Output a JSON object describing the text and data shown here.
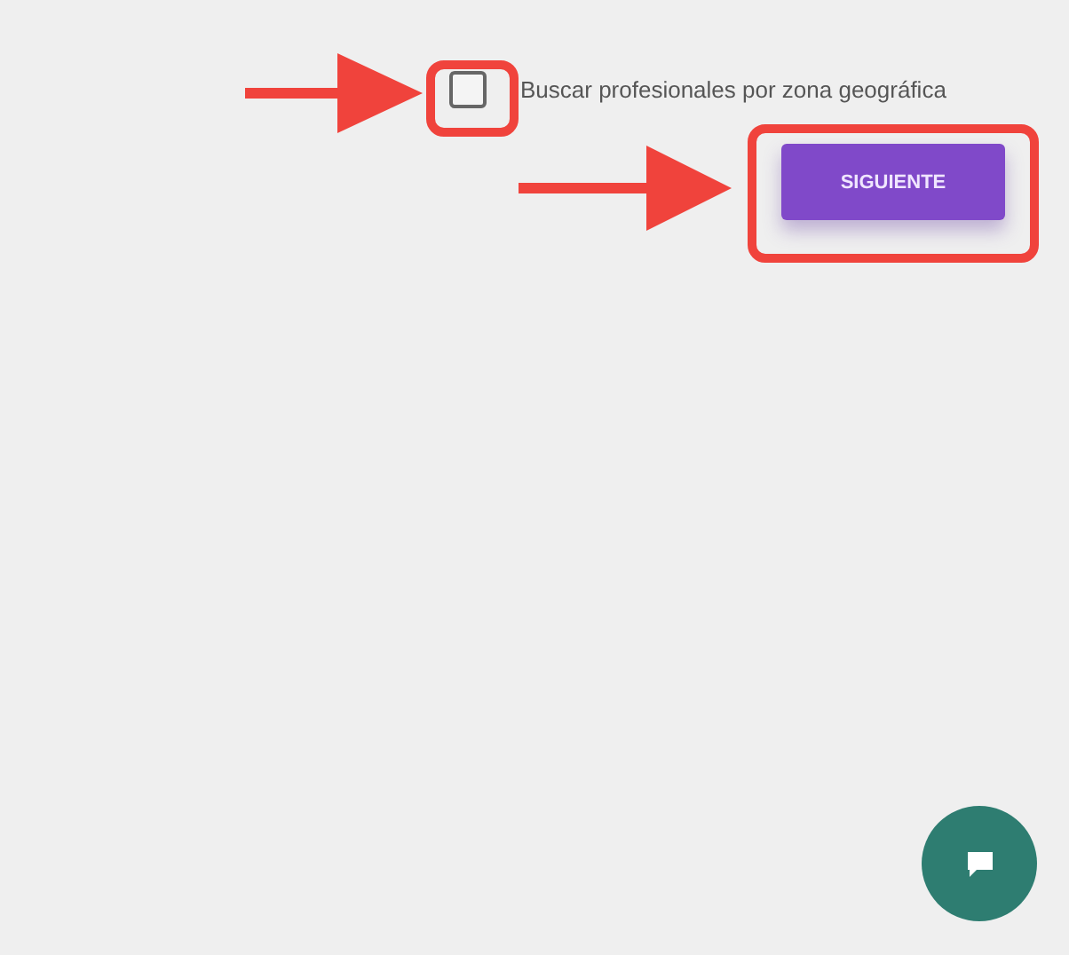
{
  "option": {
    "label": "Buscar profesionales por zona geográfica",
    "checked": false
  },
  "next_button": {
    "label": "SIGUIENTE"
  },
  "annotations": [
    {
      "kind": "arrow"
    },
    {
      "kind": "arrow"
    }
  ]
}
